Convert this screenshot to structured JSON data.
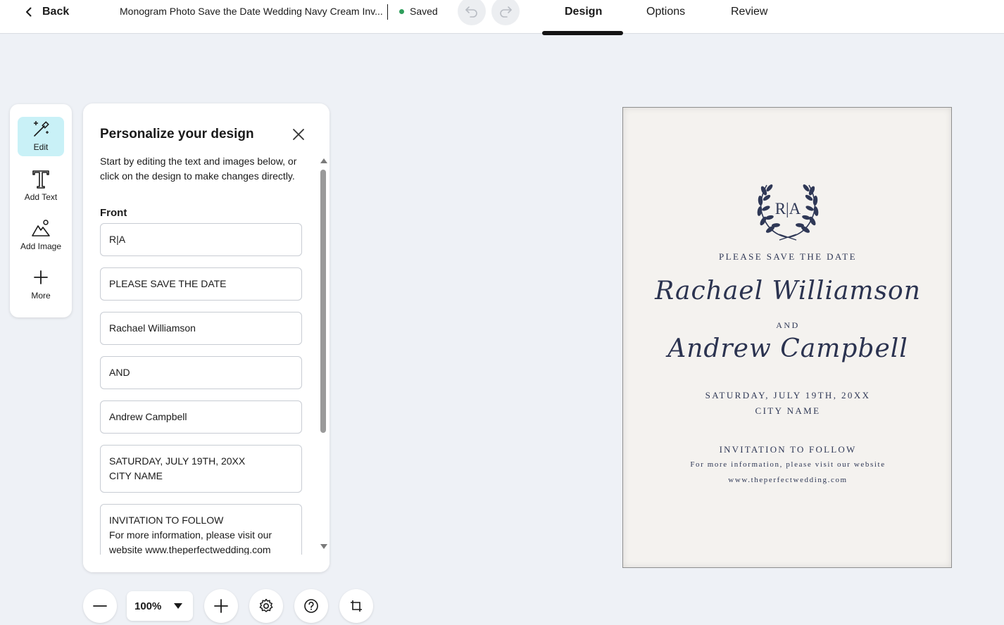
{
  "header": {
    "back_label": "Back",
    "document_title": "Monogram Photo Save the Date Wedding Navy Cream Inv...",
    "save_status": "Saved",
    "tabs": [
      {
        "label": "Design",
        "active": true
      },
      {
        "label": "Options",
        "active": false
      },
      {
        "label": "Review",
        "active": false
      }
    ]
  },
  "tools": [
    {
      "label": "Edit",
      "icon": "edit-wand-icon",
      "active": true
    },
    {
      "label": "Add Text",
      "icon": "text-t-icon",
      "active": false
    },
    {
      "label": "Add Image",
      "icon": "image-mountain-icon",
      "active": false
    },
    {
      "label": "More",
      "icon": "plus-icon",
      "active": false
    }
  ],
  "panel": {
    "title": "Personalize your design",
    "description": "Start by editing the text and images below, or click on the design to make changes directly.",
    "section_label": "Front",
    "fields": [
      "R|A",
      "PLEASE SAVE THE DATE",
      "Rachael Williamson",
      "AND",
      "Andrew Campbell",
      "SATURDAY, JULY 19TH, 20XX\nCITY NAME",
      "INVITATION TO FOLLOW\nFor more information, please visit our website www.theperfectwedding.com"
    ]
  },
  "zoom": {
    "level": "100%"
  },
  "card": {
    "monogram": "R|A",
    "save_the_date": "PLEASE SAVE THE DATE",
    "name1": "Rachael Williamson",
    "and": "AND",
    "name2": "Andrew Campbell",
    "date": "SATURDAY, JULY 19TH, 20XX",
    "city": "CITY NAME",
    "invite": "INVITATION TO FOLLOW",
    "more_info": "For more information, please visit our website",
    "url": "www.theperfectwedding.com"
  },
  "colors": {
    "accent_active_tool": "#c9f1f7",
    "saved_dot": "#2e9e5b",
    "card_ink": "#2f3856",
    "card_paper": "#f4f2ef",
    "page_background": "#eef1f6"
  }
}
